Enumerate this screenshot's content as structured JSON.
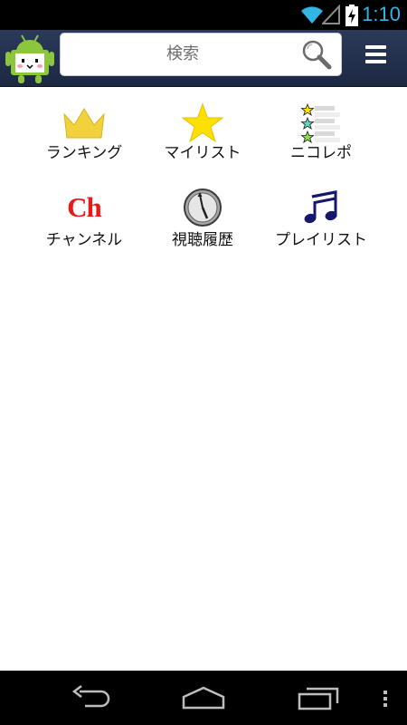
{
  "status_bar": {
    "time": "1:10",
    "icons": [
      "wifi-icon",
      "signal-icon",
      "battery-charging-icon"
    ]
  },
  "header": {
    "logo_icon": "niconico-android-logo",
    "search_placeholder": "検索",
    "search_icon": "magnifier-icon",
    "menu_icon": "hamburger-menu-icon"
  },
  "menu_items": [
    {
      "label": "ランキング",
      "icon": "crown-icon"
    },
    {
      "label": "マイリスト",
      "icon": "star-icon"
    },
    {
      "label": "ニコレポ",
      "icon": "star-list-icon"
    },
    {
      "label": "チャンネル",
      "icon": "channel-icon",
      "icon_text": "Ch"
    },
    {
      "label": "視聴履歴",
      "icon": "clock-icon"
    },
    {
      "label": "プレイリスト",
      "icon": "music-note-icon"
    }
  ],
  "nav_bar": {
    "buttons": [
      "back-icon",
      "home-icon",
      "recent-apps-icon",
      "overflow-menu-icon"
    ]
  },
  "colors": {
    "header_bg": "#25314e",
    "accent_blue": "#33b5e5",
    "crown_gold": "#f2d23c",
    "star_yellow": "#fde000",
    "channel_red": "#e31b1b",
    "note_navy": "#14176e"
  }
}
